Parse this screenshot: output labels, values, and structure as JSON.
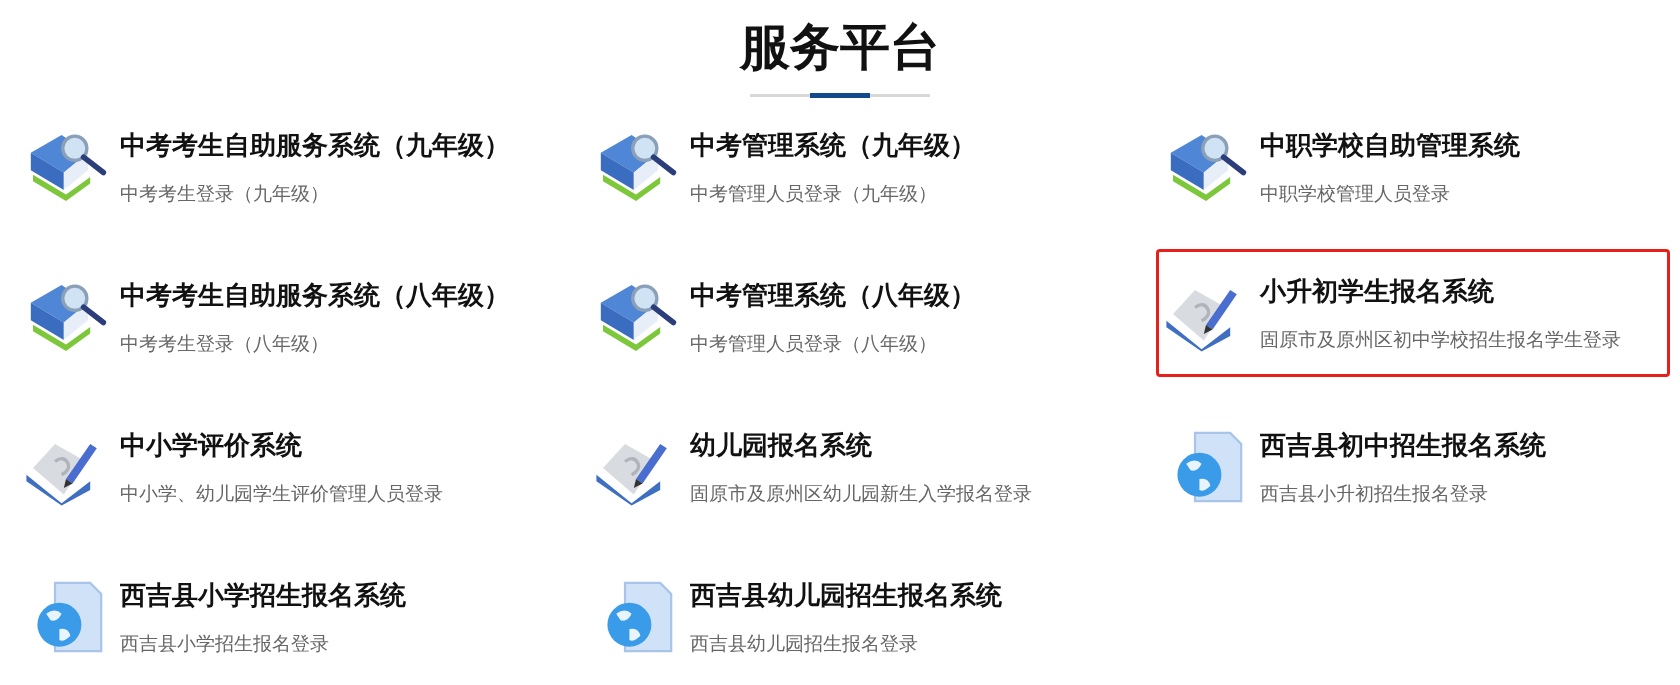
{
  "heading": "服务平台",
  "systems": [
    {
      "kind": "books",
      "title": "中考考生自助服务系统（九年级）",
      "subtitle": "中考考生登录（九年级）",
      "highlighted": false
    },
    {
      "kind": "books",
      "title": "中考管理系统（九年级）",
      "subtitle": "中考管理人员登录（九年级）",
      "highlighted": false
    },
    {
      "kind": "books",
      "title": "中职学校自助管理系统",
      "subtitle": "中职学校管理人员登录",
      "highlighted": false
    },
    {
      "kind": "books",
      "title": "中考考生自助服务系统（八年级）",
      "subtitle": "中考考生登录（八年级）",
      "highlighted": false
    },
    {
      "kind": "books",
      "title": "中考管理系统（八年级）",
      "subtitle": "中考管理人员登录（八年级）",
      "highlighted": false
    },
    {
      "kind": "pencil",
      "title": "小升初学生报名系统",
      "subtitle": "固原市及原州区初中学校招生报名学生登录",
      "highlighted": true
    },
    {
      "kind": "pencil",
      "title": "中小学评价系统",
      "subtitle": "中小学、幼儿园学生评价管理人员登录",
      "highlighted": false
    },
    {
      "kind": "pencil",
      "title": "幼儿园报名系统",
      "subtitle": "固原市及原州区幼儿园新生入学报名登录",
      "highlighted": false
    },
    {
      "kind": "globe",
      "title": "西吉县初中招生报名系统",
      "subtitle": "西吉县小升初招生报名登录",
      "highlighted": false
    },
    {
      "kind": "globe",
      "title": "西吉县小学招生报名系统",
      "subtitle": "西吉县小学招生报名登录",
      "highlighted": false
    },
    {
      "kind": "globe",
      "title": "西吉县幼儿园招生报名系统",
      "subtitle": "西吉县幼儿园招生报名登录",
      "highlighted": false
    }
  ]
}
